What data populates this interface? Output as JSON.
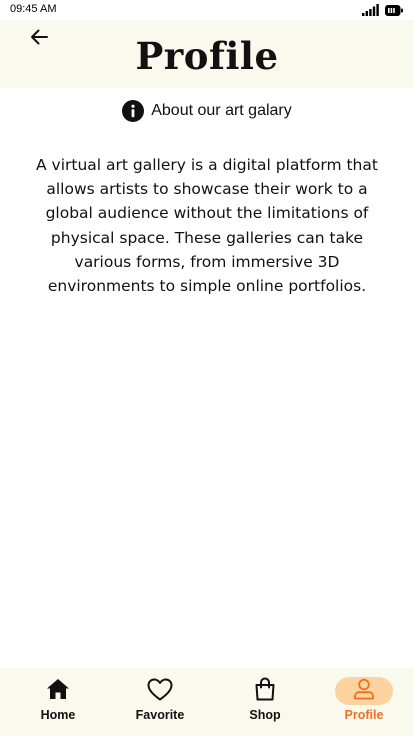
{
  "status_bar": {
    "time": "09:45 AM",
    "icons": [
      "signal-icon",
      "battery-icon"
    ]
  },
  "header": {
    "back_icon": "arrow-left-icon",
    "title": "Profile"
  },
  "about": {
    "icon": "info-icon",
    "label": "About our art galary"
  },
  "description": "A virtual art gallery is a digital platform that allows artists to showcase their work to a global audience without the limitations of physical space. These galleries can take various forms, from immersive 3D environments to simple online portfolios.",
  "bottom_nav": {
    "active": "Profile",
    "items": [
      {
        "label": "Home",
        "icon": "home-icon"
      },
      {
        "label": "Favorite",
        "icon": "heart-icon"
      },
      {
        "label": "Shop",
        "icon": "shopping-bag-icon"
      },
      {
        "label": "Profile",
        "icon": "person-icon"
      }
    ]
  },
  "colors": {
    "header_background": "#faf9ee",
    "nav_background": "#faf9ee",
    "accent": "#f26f1f",
    "active_pill": "#fed3a0",
    "text": "#111111"
  }
}
